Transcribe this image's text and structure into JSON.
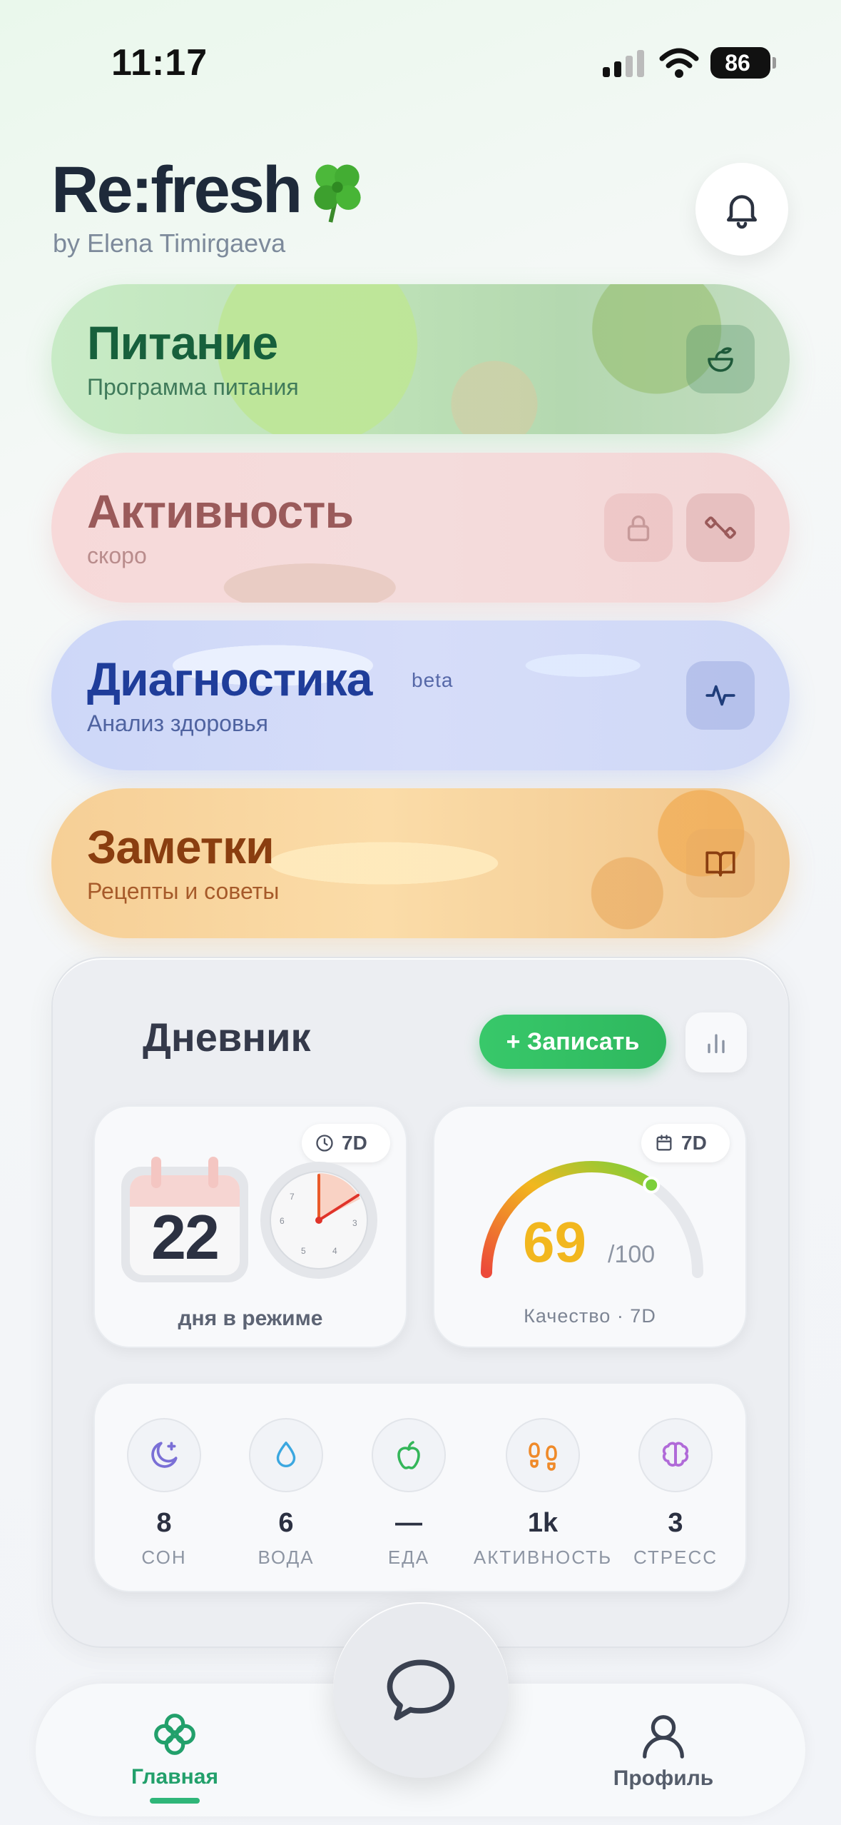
{
  "status": {
    "time": "11:17",
    "battery": "86"
  },
  "header": {
    "title": "Re:fresh",
    "subtitle": "by Elena Timirgaeva"
  },
  "cards": [
    {
      "title": "Питание",
      "subtitle": "Программа питания",
      "icon": "salad-bowl-icon"
    },
    {
      "title": "Активность",
      "subtitle": "скоро",
      "icon": "dumbbell-icon"
    },
    {
      "title": "Диагностика",
      "badge": "beta",
      "subtitle": "Анализ здоровья",
      "icon": "pulse-icon"
    },
    {
      "title": "Заметки",
      "subtitle": "Рецепты и советы",
      "icon": "book-icon"
    }
  ],
  "diary": {
    "title": "Дневник",
    "record_label": "+ Записать",
    "streak": {
      "period": "7D",
      "days": "22",
      "label": "дня в режиме"
    },
    "quality": {
      "period": "7D",
      "score": "69",
      "max": "/100",
      "label": "Качество · 7D",
      "score_fraction": 0.69
    },
    "metrics": [
      {
        "value": "8",
        "label": "СОН",
        "icon": "moon-icon"
      },
      {
        "value": "6",
        "label": "ВОДА",
        "icon": "water-drop-icon"
      },
      {
        "value": "—",
        "label": "ЕДА",
        "icon": "apple-icon"
      },
      {
        "value": "1k",
        "label": "АКТИВНОСТЬ",
        "icon": "footprints-icon"
      },
      {
        "value": "3",
        "label": "СТРЕСС",
        "icon": "brain-icon"
      }
    ]
  },
  "nav": {
    "home_label": "Главная",
    "profile_label": "Профиль"
  },
  "colors": {
    "accent": "#2fb679",
    "score": "#f2b71e"
  }
}
